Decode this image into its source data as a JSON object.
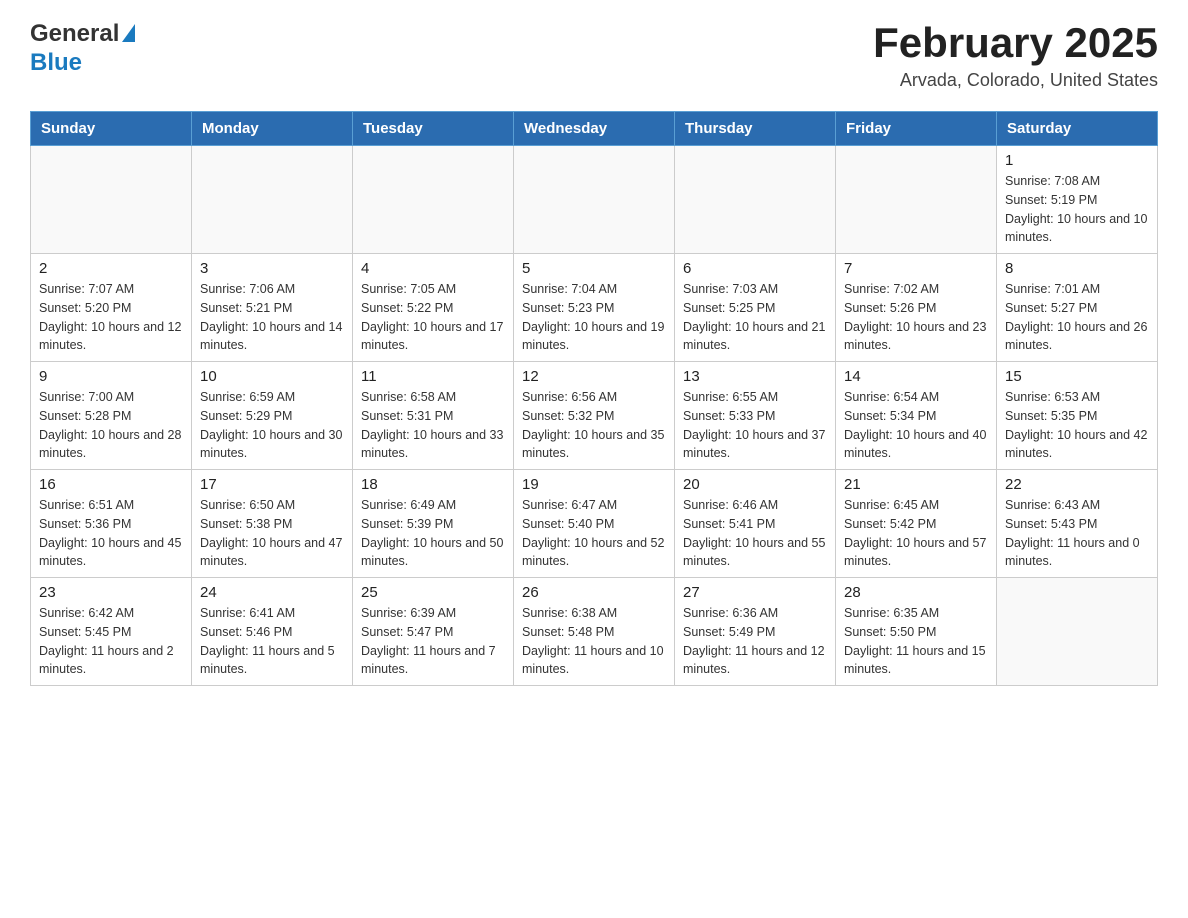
{
  "header": {
    "logo_general": "General",
    "logo_blue": "Blue",
    "month_title": "February 2025",
    "location": "Arvada, Colorado, United States"
  },
  "weekdays": [
    "Sunday",
    "Monday",
    "Tuesday",
    "Wednesday",
    "Thursday",
    "Friday",
    "Saturday"
  ],
  "weeks": [
    [
      {
        "day": "",
        "info": ""
      },
      {
        "day": "",
        "info": ""
      },
      {
        "day": "",
        "info": ""
      },
      {
        "day": "",
        "info": ""
      },
      {
        "day": "",
        "info": ""
      },
      {
        "day": "",
        "info": ""
      },
      {
        "day": "1",
        "info": "Sunrise: 7:08 AM\nSunset: 5:19 PM\nDaylight: 10 hours and 10 minutes."
      }
    ],
    [
      {
        "day": "2",
        "info": "Sunrise: 7:07 AM\nSunset: 5:20 PM\nDaylight: 10 hours and 12 minutes."
      },
      {
        "day": "3",
        "info": "Sunrise: 7:06 AM\nSunset: 5:21 PM\nDaylight: 10 hours and 14 minutes."
      },
      {
        "day": "4",
        "info": "Sunrise: 7:05 AM\nSunset: 5:22 PM\nDaylight: 10 hours and 17 minutes."
      },
      {
        "day": "5",
        "info": "Sunrise: 7:04 AM\nSunset: 5:23 PM\nDaylight: 10 hours and 19 minutes."
      },
      {
        "day": "6",
        "info": "Sunrise: 7:03 AM\nSunset: 5:25 PM\nDaylight: 10 hours and 21 minutes."
      },
      {
        "day": "7",
        "info": "Sunrise: 7:02 AM\nSunset: 5:26 PM\nDaylight: 10 hours and 23 minutes."
      },
      {
        "day": "8",
        "info": "Sunrise: 7:01 AM\nSunset: 5:27 PM\nDaylight: 10 hours and 26 minutes."
      }
    ],
    [
      {
        "day": "9",
        "info": "Sunrise: 7:00 AM\nSunset: 5:28 PM\nDaylight: 10 hours and 28 minutes."
      },
      {
        "day": "10",
        "info": "Sunrise: 6:59 AM\nSunset: 5:29 PM\nDaylight: 10 hours and 30 minutes."
      },
      {
        "day": "11",
        "info": "Sunrise: 6:58 AM\nSunset: 5:31 PM\nDaylight: 10 hours and 33 minutes."
      },
      {
        "day": "12",
        "info": "Sunrise: 6:56 AM\nSunset: 5:32 PM\nDaylight: 10 hours and 35 minutes."
      },
      {
        "day": "13",
        "info": "Sunrise: 6:55 AM\nSunset: 5:33 PM\nDaylight: 10 hours and 37 minutes."
      },
      {
        "day": "14",
        "info": "Sunrise: 6:54 AM\nSunset: 5:34 PM\nDaylight: 10 hours and 40 minutes."
      },
      {
        "day": "15",
        "info": "Sunrise: 6:53 AM\nSunset: 5:35 PM\nDaylight: 10 hours and 42 minutes."
      }
    ],
    [
      {
        "day": "16",
        "info": "Sunrise: 6:51 AM\nSunset: 5:36 PM\nDaylight: 10 hours and 45 minutes."
      },
      {
        "day": "17",
        "info": "Sunrise: 6:50 AM\nSunset: 5:38 PM\nDaylight: 10 hours and 47 minutes."
      },
      {
        "day": "18",
        "info": "Sunrise: 6:49 AM\nSunset: 5:39 PM\nDaylight: 10 hours and 50 minutes."
      },
      {
        "day": "19",
        "info": "Sunrise: 6:47 AM\nSunset: 5:40 PM\nDaylight: 10 hours and 52 minutes."
      },
      {
        "day": "20",
        "info": "Sunrise: 6:46 AM\nSunset: 5:41 PM\nDaylight: 10 hours and 55 minutes."
      },
      {
        "day": "21",
        "info": "Sunrise: 6:45 AM\nSunset: 5:42 PM\nDaylight: 10 hours and 57 minutes."
      },
      {
        "day": "22",
        "info": "Sunrise: 6:43 AM\nSunset: 5:43 PM\nDaylight: 11 hours and 0 minutes."
      }
    ],
    [
      {
        "day": "23",
        "info": "Sunrise: 6:42 AM\nSunset: 5:45 PM\nDaylight: 11 hours and 2 minutes."
      },
      {
        "day": "24",
        "info": "Sunrise: 6:41 AM\nSunset: 5:46 PM\nDaylight: 11 hours and 5 minutes."
      },
      {
        "day": "25",
        "info": "Sunrise: 6:39 AM\nSunset: 5:47 PM\nDaylight: 11 hours and 7 minutes."
      },
      {
        "day": "26",
        "info": "Sunrise: 6:38 AM\nSunset: 5:48 PM\nDaylight: 11 hours and 10 minutes."
      },
      {
        "day": "27",
        "info": "Sunrise: 6:36 AM\nSunset: 5:49 PM\nDaylight: 11 hours and 12 minutes."
      },
      {
        "day": "28",
        "info": "Sunrise: 6:35 AM\nSunset: 5:50 PM\nDaylight: 11 hours and 15 minutes."
      },
      {
        "day": "",
        "info": ""
      }
    ]
  ]
}
